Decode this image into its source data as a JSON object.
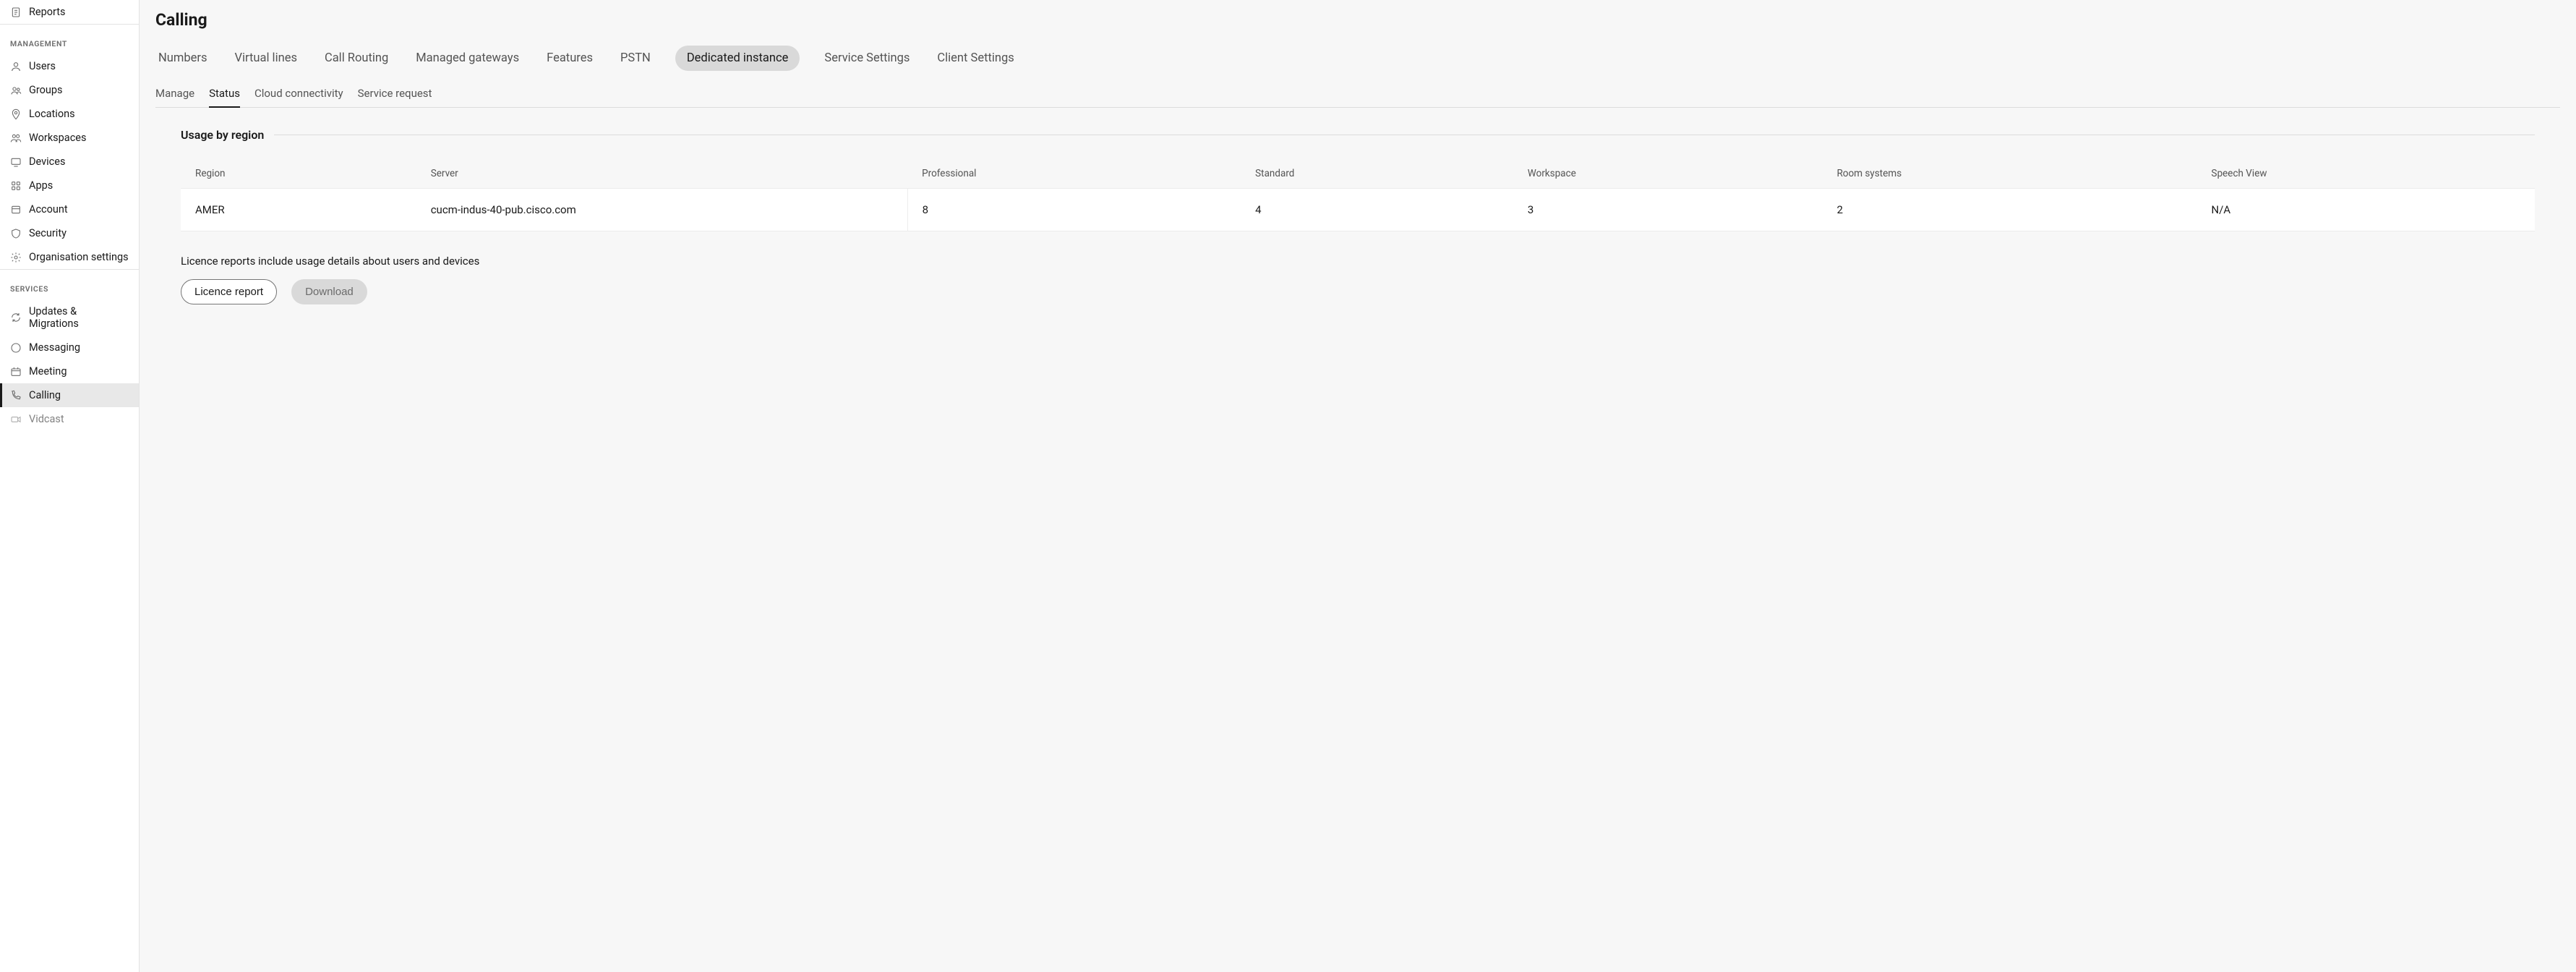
{
  "sidebar": {
    "reports_label": "Reports",
    "management_label": "MANAGEMENT",
    "services_label": "SERVICES",
    "management_items": [
      {
        "label": "Users"
      },
      {
        "label": "Groups"
      },
      {
        "label": "Locations"
      },
      {
        "label": "Workspaces"
      },
      {
        "label": "Devices"
      },
      {
        "label": "Apps"
      },
      {
        "label": "Account"
      },
      {
        "label": "Security"
      },
      {
        "label": "Organisation settings"
      }
    ],
    "services_items": [
      {
        "label": "Updates & Migrations"
      },
      {
        "label": "Messaging"
      },
      {
        "label": "Meeting"
      },
      {
        "label": "Calling"
      },
      {
        "label": "Vidcast"
      }
    ]
  },
  "page": {
    "title": "Calling"
  },
  "top_tabs": [
    {
      "label": "Numbers"
    },
    {
      "label": "Virtual lines"
    },
    {
      "label": "Call Routing"
    },
    {
      "label": "Managed gateways"
    },
    {
      "label": "Features"
    },
    {
      "label": "PSTN"
    },
    {
      "label": "Dedicated instance"
    },
    {
      "label": "Service Settings"
    },
    {
      "label": "Client Settings"
    }
  ],
  "sub_tabs": [
    {
      "label": "Manage"
    },
    {
      "label": "Status"
    },
    {
      "label": "Cloud connectivity"
    },
    {
      "label": "Service request"
    }
  ],
  "section": {
    "usage_by_region": "Usage by region"
  },
  "table": {
    "headers": {
      "region": "Region",
      "server": "Server",
      "professional": "Professional",
      "standard": "Standard",
      "workspace": "Workspace",
      "room_systems": "Room systems",
      "speech_view": "Speech View"
    },
    "rows": [
      {
        "region": "AMER",
        "server": "cucm-indus-40-pub.cisco.com",
        "professional": "8",
        "standard": "4",
        "workspace": "3",
        "room_systems": "2",
        "speech_view": "N/A"
      }
    ]
  },
  "licence": {
    "text": "Licence reports include usage details about users and devices",
    "report_btn": "Licence report",
    "download_btn": "Download"
  }
}
